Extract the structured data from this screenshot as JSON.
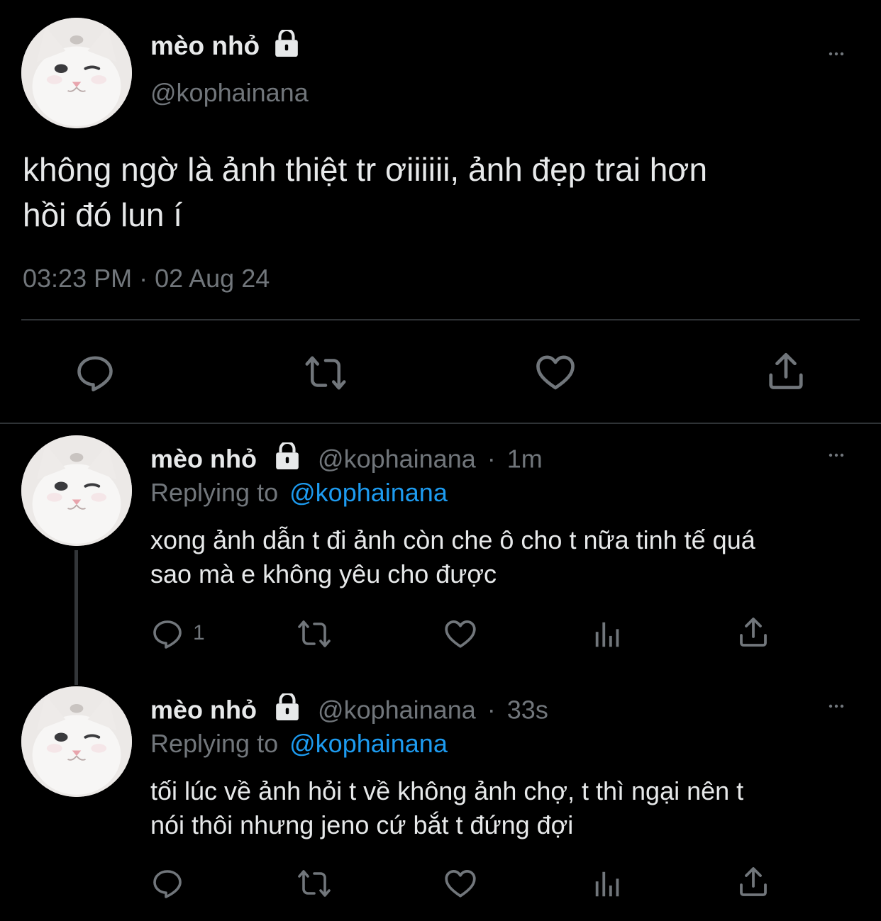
{
  "main_tweet": {
    "display_name": "mèo nhỏ",
    "handle": "@kophainana",
    "text_line1": "không ngờ là ảnh thiệt tr ơiiiiii, ảnh đẹp trai hơn",
    "text_line2": "hồi đó lun í",
    "timestamp": "03:23 PM · 02 Aug 24"
  },
  "replies": [
    {
      "display_name": "mèo nhỏ",
      "handle": "@kophainana",
      "separator": "·",
      "time": "1m",
      "replying_prefix": "Replying to",
      "replying_to": "@kophainana",
      "text_line1": "xong ảnh dẫn t đi ảnh còn che ô cho t nữa tinh tế quá",
      "text_line2": "sao mà e không yêu cho được",
      "reply_count": "1"
    },
    {
      "display_name": "mèo nhỏ",
      "handle": "@kophainana",
      "separator": "·",
      "time": "33s",
      "replying_prefix": "Replying to",
      "replying_to": "@kophainana",
      "text_line1": "tối lúc về ảnh hỏi t về không ảnh chợ, t thì ngại nên t",
      "text_line2": "nói thôi nhưng jeno cứ bắt t đứng đợi",
      "reply_count": ""
    }
  ],
  "icons": {
    "lock": "lock-icon",
    "more": "more-icon",
    "reply": "reply-icon",
    "retweet": "retweet-icon",
    "like": "heart-icon",
    "views": "views-icon",
    "share": "share-icon"
  },
  "colors": {
    "background": "#000000",
    "text": "#e7e9ea",
    "muted": "#71767b",
    "link": "#1d9bf0",
    "divider": "#2f3336"
  }
}
